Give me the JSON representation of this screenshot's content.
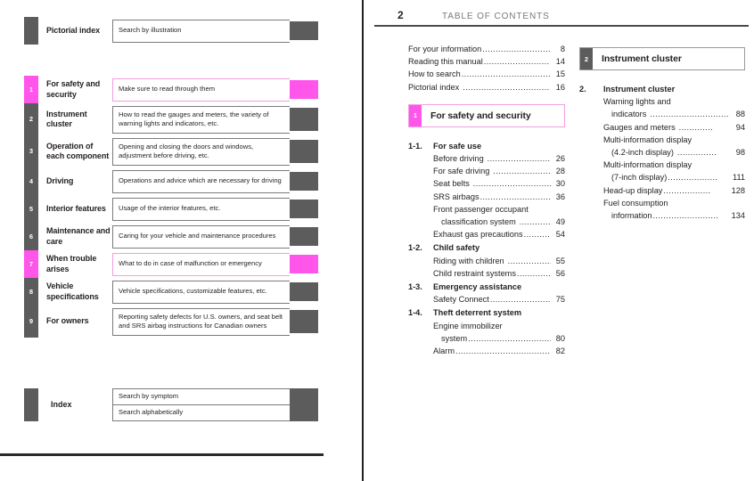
{
  "left_page": {
    "top_item": {
      "chip": "",
      "title": "Pictorial index",
      "description": "Search by illustration",
      "highlight": false
    },
    "chapters": [
      {
        "chip": "1",
        "title": "For safety and security",
        "description": "Make sure to read through them",
        "highlight": true
      },
      {
        "chip": "2",
        "title": "Instrument cluster",
        "description": "How to read the gauges and meters, the variety of warning lights and indicators, etc.",
        "highlight": false
      },
      {
        "chip": "3",
        "title": "Operation of each component",
        "description": "Opening and closing the doors and windows, adjustment before driving, etc.",
        "highlight": false
      },
      {
        "chip": "4",
        "title": "Driving",
        "description": "Operations and advice which are necessary for driving",
        "highlight": false
      },
      {
        "chip": "5",
        "title": "Interior features",
        "description": "Usage of the interior features, etc.",
        "highlight": false
      },
      {
        "chip": "6",
        "title": "Maintenance and care",
        "description": "Caring for your vehicle and maintenance procedures",
        "highlight": false
      },
      {
        "chip": "7",
        "title": "When trouble arises",
        "description": "What to do in case of malfunction or emergency",
        "highlight": true
      },
      {
        "chip": "8",
        "title": "Vehicle specifications",
        "description": "Vehicle specifications, customizable features, etc.",
        "highlight": false
      },
      {
        "chip": "9",
        "title": "For owners",
        "description": "Reporting safety defects for U.S. owners, and seat belt and SRS airbag instructions for Canadian owners",
        "highlight": false
      }
    ],
    "index": {
      "title": "Index",
      "rows": [
        "Search by symptom",
        "Search alphabetically"
      ]
    }
  },
  "right_page": {
    "header": {
      "page_number": "2",
      "title": "TABLE OF CONTENTS"
    },
    "front_matter": [
      {
        "label": "For your information",
        "page": "8"
      },
      {
        "label": "Reading this manual",
        "page": "14"
      },
      {
        "label": "How to search",
        "page": "15"
      },
      {
        "label": "Pictorial index",
        "page": "16"
      }
    ],
    "section_1": {
      "chip": "1",
      "label": "For safety and security",
      "groups": [
        {
          "num": "1-1.",
          "title": "For safe use",
          "entries": [
            {
              "lines": [
                "Before driving"
              ],
              "page": "26"
            },
            {
              "lines": [
                "For safe driving"
              ],
              "page": "28"
            },
            {
              "lines": [
                "Seat belts"
              ],
              "page": "30"
            },
            {
              "lines": [
                "SRS airbags"
              ],
              "page": "36"
            },
            {
              "lines": [
                "Front passenger occupant",
                "classification system"
              ],
              "page": "49"
            },
            {
              "lines": [
                "Exhaust gas precautions"
              ],
              "page": "54"
            }
          ]
        },
        {
          "num": "1-2.",
          "title": "Child safety",
          "entries": [
            {
              "lines": [
                "Riding with children"
              ],
              "page": "55"
            },
            {
              "lines": [
                "Child restraint systems"
              ],
              "page": "56"
            }
          ]
        },
        {
          "num": "1-3.",
          "title": "Emergency assistance",
          "entries": [
            {
              "lines": [
                "Safety Connect"
              ],
              "page": "75"
            }
          ]
        },
        {
          "num": "1-4.",
          "title": "Theft deterrent system",
          "entries": [
            {
              "lines": [
                "Engine immobilizer",
                "system"
              ],
              "page": "80"
            },
            {
              "lines": [
                "Alarm"
              ],
              "page": "82"
            }
          ]
        }
      ]
    },
    "section_2": {
      "chip": "2",
      "label": "Instrument cluster",
      "group": {
        "num": "2.",
        "title": "Instrument cluster",
        "entries": [
          {
            "lines": [
              "Warning lights and",
              "indicators"
            ],
            "page": "88"
          },
          {
            "lines": [
              "Gauges and meters"
            ],
            "page": "94"
          },
          {
            "lines": [
              "Multi-information display",
              "(4.2-inch display)"
            ],
            "page": "98"
          },
          {
            "lines": [
              "Multi-information display",
              "(7-inch display)"
            ],
            "page": "111"
          },
          {
            "lines": [
              "Head-up display"
            ],
            "page": "128"
          },
          {
            "lines": [
              "Fuel consumption",
              "information"
            ],
            "page": "134"
          }
        ]
      }
    }
  },
  "colors": {
    "highlight": "#ff55ea",
    "tab_gray": "#5c5c5c",
    "text": "#231f20",
    "header_gray": "#7a7a7a"
  }
}
